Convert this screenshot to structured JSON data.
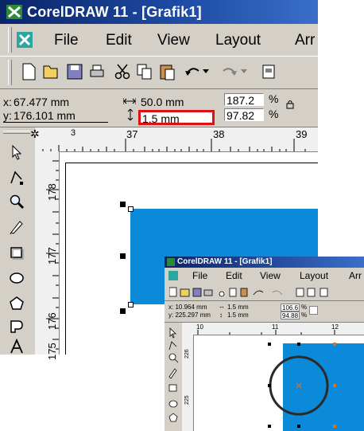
{
  "main": {
    "title": "CorelDRAW 11 - [Grafik1]",
    "menu": {
      "file": "File",
      "edit": "Edit",
      "view": "View",
      "layout": "Layout",
      "arrange": "Arr"
    },
    "props": {
      "x_label": "x:",
      "x_value": "67.477 mm",
      "y_label": "y:",
      "y_value": "176.101 mm",
      "w_value": "50.0 mm",
      "h_value": "1.5 mm",
      "sx_value": "187.2",
      "sy_value": "97.82",
      "pct": "%"
    },
    "hruler_labels": [
      "37",
      "38",
      "39"
    ],
    "vruler_labels": [
      "178",
      "177",
      "176",
      "175"
    ],
    "colors": {
      "rect_fill": "#0a8ad8",
      "highlight": "#e01010",
      "title_bar": "#0a246a"
    }
  },
  "inset": {
    "title": "CorelDRAW 11 - [Grafik1]",
    "menu": {
      "file": "File",
      "edit": "Edit",
      "view": "View",
      "layout": "Layout",
      "arrange": "Arr"
    },
    "props": {
      "x_label": "x:",
      "x_value": "10.964 mm",
      "y_label": "y:",
      "y_value": "225.297 mm",
      "w_value": "1.5 mm",
      "h_value": "1.5 mm",
      "sx_value": "106.6",
      "sy_value": "94.88",
      "pct": "%"
    },
    "hruler_labels": [
      "10",
      "11",
      "12"
    ],
    "vruler_labels": [
      "226",
      "225"
    ]
  }
}
